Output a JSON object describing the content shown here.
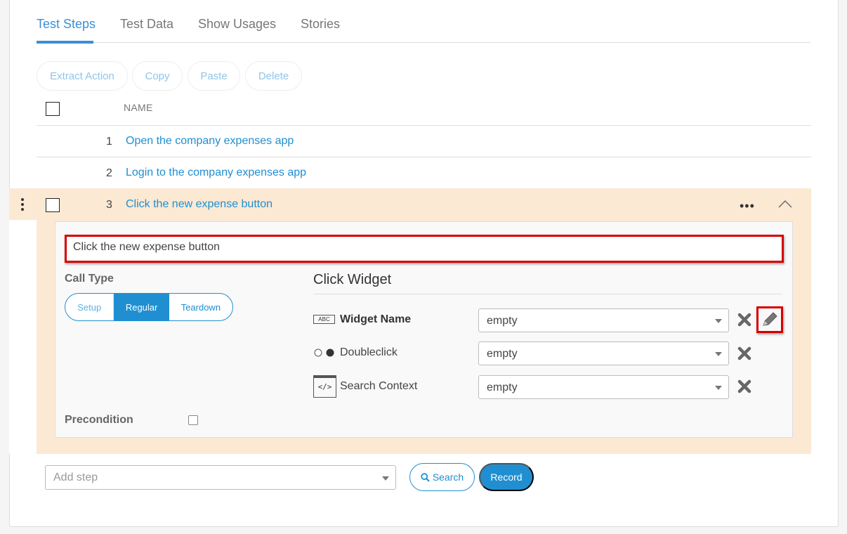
{
  "tabs": [
    {
      "label": "Test Steps",
      "active": true
    },
    {
      "label": "Test Data"
    },
    {
      "label": "Show Usages"
    },
    {
      "label": "Stories"
    }
  ],
  "toolbar": {
    "extract_action": "Extract Action",
    "copy": "Copy",
    "paste": "Paste",
    "delete": "Delete"
  },
  "table": {
    "header_name": "NAME",
    "rows": [
      {
        "num": "1",
        "name": "Open the company expenses app"
      },
      {
        "num": "2",
        "name": "Login to the company expenses app"
      },
      {
        "num": "3",
        "name": "Click the new expense button",
        "expanded": true
      }
    ]
  },
  "detail": {
    "description": "Click the new expense button",
    "call_type_label": "Call Type",
    "call_types": [
      "Setup",
      "Regular",
      "Teardown"
    ],
    "call_type_selected": "Regular",
    "precondition_label": "Precondition",
    "widget_title": "Click Widget",
    "params": [
      {
        "label": "Widget Name",
        "icon": "abc-text-icon",
        "icon_text": "ABC",
        "value": "empty",
        "bold": true
      },
      {
        "label": "Doubleclick",
        "icon": "radio-toggle-icon",
        "value": "empty"
      },
      {
        "label": "Search Context",
        "icon": "code-window-icon",
        "icon_text": "</>",
        "value": "empty"
      }
    ]
  },
  "footer": {
    "add_step_placeholder": "Add step",
    "search": "Search",
    "record": "Record"
  },
  "colors": {
    "accent": "#1f8fd1",
    "selected_row": "#fbe9d3",
    "highlight_border": "#d60000"
  }
}
